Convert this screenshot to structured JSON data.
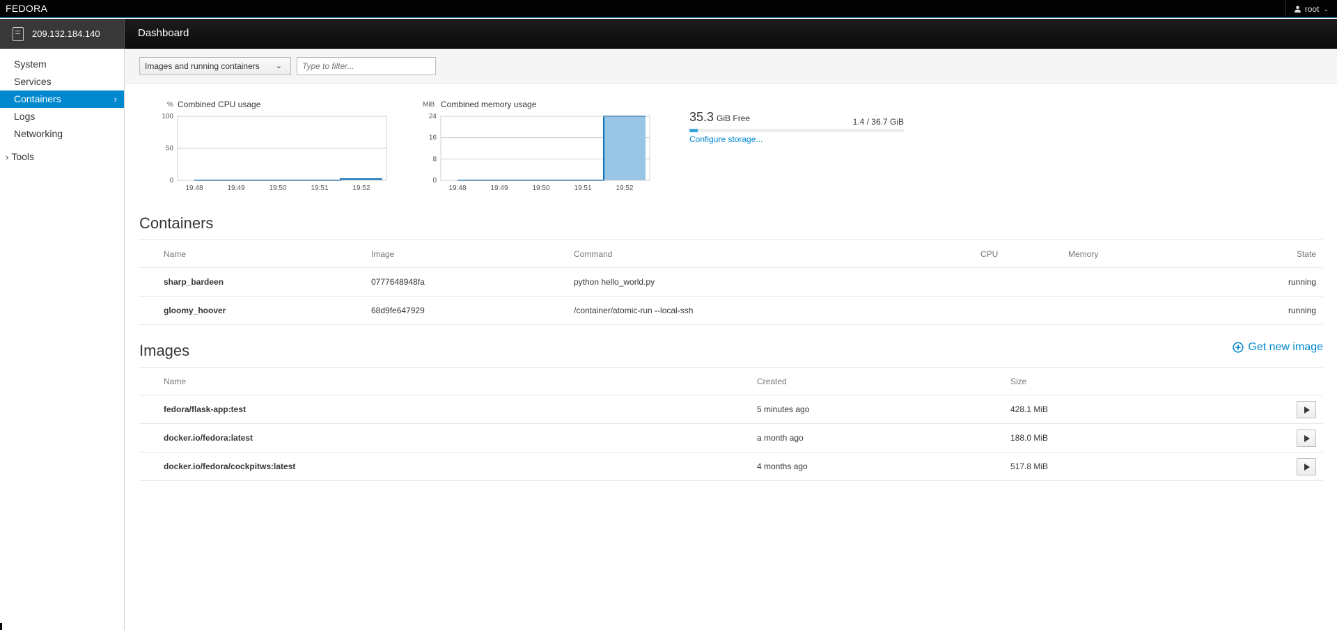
{
  "topbar": {
    "brand": "FEDORA",
    "user": "root"
  },
  "host": {
    "address": "209.132.184.140"
  },
  "page": {
    "title": "Dashboard"
  },
  "sidebar": {
    "items": [
      {
        "label": "System"
      },
      {
        "label": "Services"
      },
      {
        "label": "Containers"
      },
      {
        "label": "Logs"
      },
      {
        "label": "Networking"
      }
    ],
    "tools": "Tools"
  },
  "filter": {
    "dropdown": "Images and running containers",
    "placeholder": "Type to filter..."
  },
  "charts": [
    {
      "title": "Combined CPU usage",
      "unit": "%",
      "yticks": [
        "100",
        "50",
        "0"
      ],
      "xticks": [
        "19:48",
        "19:49",
        "19:50",
        "19:51",
        "19:52"
      ]
    },
    {
      "title": "Combined memory usage",
      "unit": "MiB",
      "yticks": [
        "24",
        "16",
        "8",
        "0"
      ],
      "xticks": [
        "19:48",
        "19:49",
        "19:50",
        "19:51",
        "19:52"
      ]
    }
  ],
  "chart_data": [
    {
      "type": "area",
      "title": "Combined CPU usage",
      "ylabel": "%",
      "ylim": [
        0,
        100
      ],
      "x": [
        "19:48",
        "19:49",
        "19:50",
        "19:51",
        "19:51.5",
        "19:52",
        "19:52.5"
      ],
      "values": [
        0,
        0,
        0,
        0,
        2,
        2,
        2
      ]
    },
    {
      "type": "area",
      "title": "Combined memory usage",
      "ylabel": "MiB",
      "ylim": [
        0,
        24
      ],
      "x": [
        "19:48",
        "19:49",
        "19:50",
        "19:51",
        "19:51.5",
        "19:52",
        "19:52.5"
      ],
      "values": [
        0,
        0,
        0,
        0,
        24,
        24,
        24
      ]
    }
  ],
  "storage": {
    "free": "35.3",
    "free_unit": "GiB Free",
    "ratio": "1.4 / 36.7 GiB",
    "used_fraction": 0.038,
    "link": "Configure storage..."
  },
  "containers": {
    "title": "Containers",
    "headers": {
      "name": "Name",
      "image": "Image",
      "command": "Command",
      "cpu": "CPU",
      "memory": "Memory",
      "state": "State"
    },
    "rows": [
      {
        "name": "sharp_bardeen",
        "image": "0777648948fa",
        "command": "python hello_world.py",
        "state": "running"
      },
      {
        "name": "gloomy_hoover",
        "image": "68d9fe647929",
        "command": "/container/atomic-run --local-ssh",
        "state": "running"
      }
    ]
  },
  "images": {
    "title": "Images",
    "get_new": "Get new image",
    "headers": {
      "name": "Name",
      "created": "Created",
      "size": "Size"
    },
    "rows": [
      {
        "name": "fedora/flask-app:test",
        "created": "5 minutes ago",
        "size": "428.1 MiB"
      },
      {
        "name": "docker.io/fedora:latest",
        "created": "a month ago",
        "size": "188.0 MiB"
      },
      {
        "name": "docker.io/fedora/cockpitws:latest",
        "created": "4 months ago",
        "size": "517.8 MiB"
      }
    ]
  },
  "colors": {
    "accent": "#0088ce",
    "chart_fill": "#99c5e6",
    "chart_line": "#0a6fb6"
  }
}
